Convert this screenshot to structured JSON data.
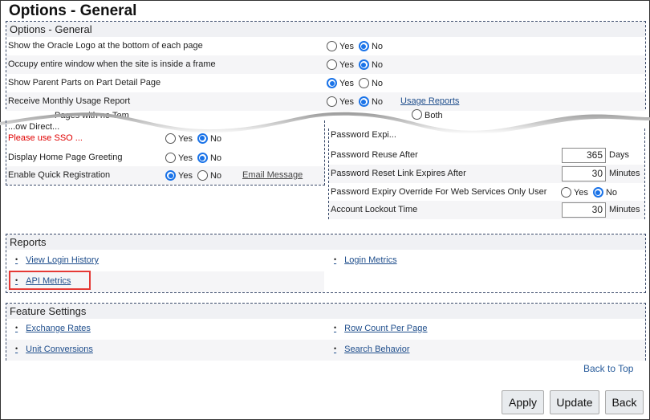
{
  "page_title": "Options - General",
  "options_general": {
    "header": "Options - General",
    "rows": [
      {
        "label": "Show the Oracle Logo at the bottom of each page",
        "value": "No"
      },
      {
        "label": "Occupy entire window when the site is inside a frame",
        "value": "No"
      },
      {
        "label": "Show Parent Parts on Part Detail Page",
        "value": "Yes"
      },
      {
        "label": "Receive Monthly Usage Report",
        "value": "No",
        "link": "Usage Reports"
      }
    ],
    "partial_row": {
      "label": "Pages with no Tem",
      "option": "Both"
    },
    "lower_rows": [
      {
        "label": "...ow Direct...",
        "value": "No"
      },
      {
        "label": "Please use SSO ...",
        "note": true
      },
      {
        "label": "Display Home Page Greeting",
        "value": "No"
      },
      {
        "label": "Enable Quick Registration",
        "value": "Yes",
        "link": "Email Message"
      }
    ],
    "yes_label": "Yes",
    "no_label": "No"
  },
  "password": {
    "partial_label": "Password Expi...",
    "rows": [
      {
        "label": "Password Reuse After",
        "value": "365",
        "unit": "Days"
      },
      {
        "label": "Password Reset Link Expires After",
        "value": "30",
        "unit": "Minutes"
      },
      {
        "label": "Password Expiry Override For Web Services Only User",
        "radio": "No"
      },
      {
        "label": "Account Lockout Time",
        "value": "30",
        "unit": "Minutes"
      }
    ]
  },
  "reports": {
    "header": "Reports",
    "links": [
      "View Login History",
      "Login Metrics",
      "API Metrics"
    ],
    "highlighted": "API Metrics"
  },
  "feature_settings": {
    "header": "Feature Settings",
    "links": [
      "Exchange Rates",
      "Row Count Per Page",
      "Unit Conversions",
      "Search Behavior"
    ]
  },
  "back_to_top": "Back to Top",
  "buttons": {
    "apply": "Apply",
    "update": "Update",
    "back": "Back"
  }
}
